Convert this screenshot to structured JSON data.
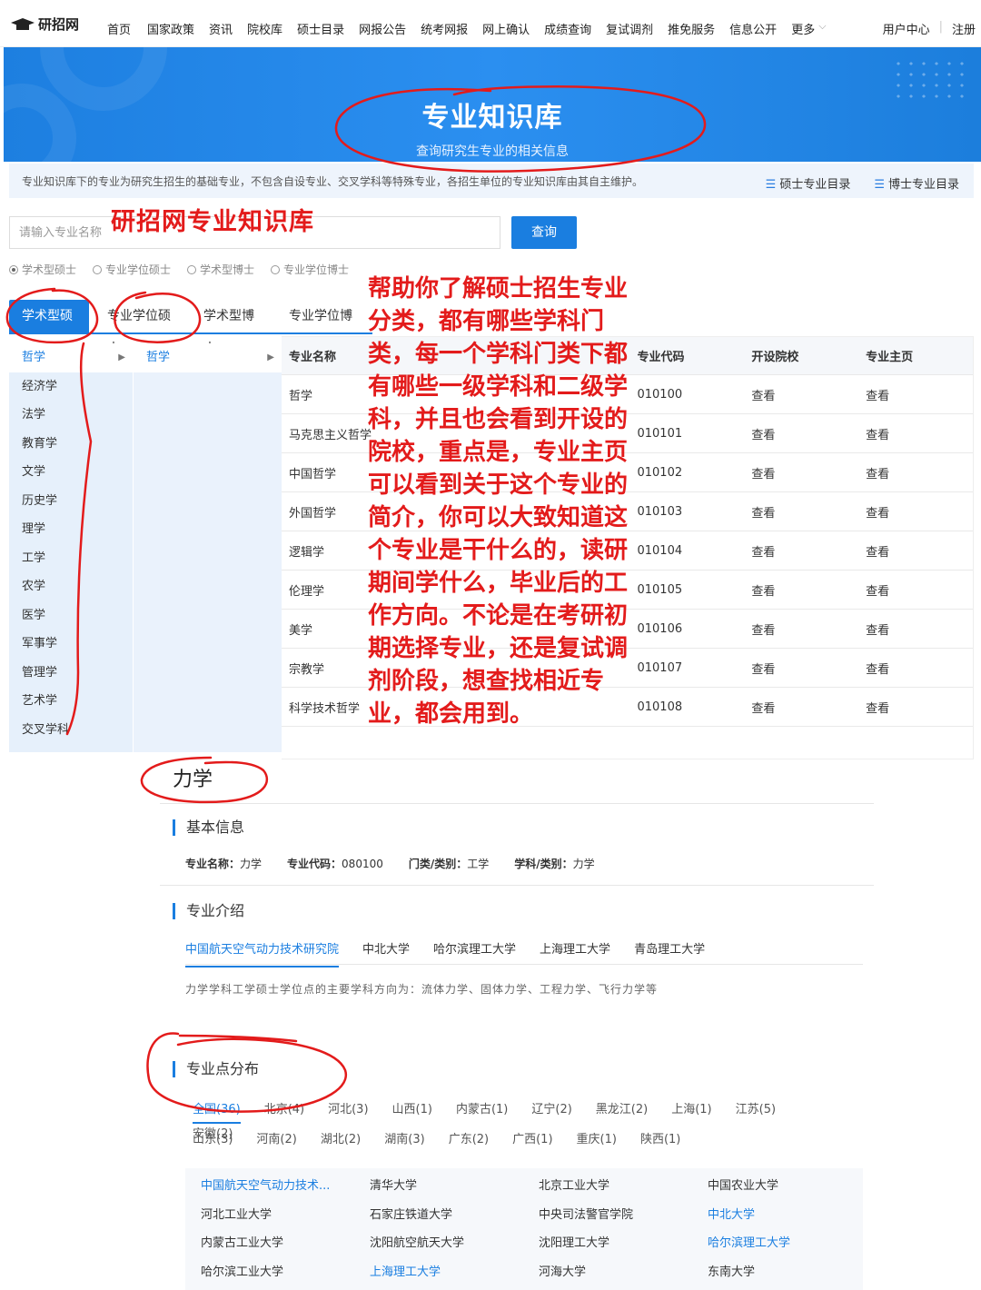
{
  "header": {
    "logo_text": "研招网",
    "nav": [
      "首页",
      "国家政策",
      "资讯",
      "院校库",
      "硕士目录",
      "网报公告",
      "统考网报",
      "网上确认",
      "成绩查询",
      "复试调剂",
      "推免服务",
      "信息公开",
      "更多"
    ],
    "user_center": "用户中心",
    "register": "注册"
  },
  "banner": {
    "title": "专业知识库",
    "subtitle": "查询研究生专业的相关信息"
  },
  "notice": {
    "text": "专业知识库下的专业为研究生招生的基础专业，不包含自设专业、交叉学科等特殊专业，各招生单位的专业知识库由其自主维护。",
    "link_master": "硕士专业目录",
    "link_doctor": "博士专业目录"
  },
  "search": {
    "placeholder": "请输入专业名称",
    "button": "查询",
    "radios": [
      "学术型硕士",
      "专业学位硕士",
      "学术型博士",
      "专业学位博士"
    ]
  },
  "tabs": [
    "学术型硕士",
    "专业学位硕士",
    "学术型博士",
    "专业学位博士"
  ],
  "categories": [
    "哲学",
    "经济学",
    "法学",
    "教育学",
    "文学",
    "历史学",
    "理学",
    "工学",
    "农学",
    "医学",
    "军事学",
    "管理学",
    "艺术学",
    "交叉学科"
  ],
  "subcategory": "哲学",
  "table": {
    "headers": [
      "专业名称",
      "专业代码",
      "开设院校",
      "专业主页"
    ],
    "rows": [
      {
        "name": "哲学",
        "code": "010100",
        "schools": "查看",
        "home": "查看"
      },
      {
        "name": "马克思主义哲学",
        "code": "010101",
        "schools": "查看",
        "home": "查看"
      },
      {
        "name": "中国哲学",
        "code": "010102",
        "schools": "查看",
        "home": "查看"
      },
      {
        "name": "外国哲学",
        "code": "010103",
        "schools": "查看",
        "home": "查看"
      },
      {
        "name": "逻辑学",
        "code": "010104",
        "schools": "查看",
        "home": "查看"
      },
      {
        "name": "伦理学",
        "code": "010105",
        "schools": "查看",
        "home": "查看"
      },
      {
        "name": "美学",
        "code": "010106",
        "schools": "查看",
        "home": "查看"
      },
      {
        "name": "宗教学",
        "code": "010107",
        "schools": "查看",
        "home": "查看"
      },
      {
        "name": "科学技术哲学",
        "code": "010108",
        "schools": "查看",
        "home": "查看"
      }
    ]
  },
  "annotation": {
    "title": "研招网专业知识库",
    "paragraph": "帮助你了解硕士招生专业分类，都有哪些学科门类，每一个学科门类下都有哪些一级学科和二级学科，并且也会看到开设的院校，重点是，专业主页可以看到关于这个专业的简介，你可以大致知道这个专业是干什么的，读研期间学什么，毕业后的工作方向。不论是在考研初期选择专业，还是复试调剂阶段，想查找相近专业，都会用到。"
  },
  "detail": {
    "major_title": "力学",
    "basic_info_heading": "基本信息",
    "fields": [
      {
        "label": "专业名称：",
        "value": "力学"
      },
      {
        "label": "专业代码：",
        "value": "080100"
      },
      {
        "label": "门类/类别：",
        "value": "工学"
      },
      {
        "label": "学科/类别：",
        "value": "力学"
      }
    ],
    "intro_heading": "专业介绍",
    "intro_tabs": [
      "中国航天空气动力技术研究院",
      "中北大学",
      "哈尔滨理工大学",
      "上海理工大学",
      "青岛理工大学"
    ],
    "intro_text": "力学学科工学硕士学位点的主要学科方向为：流体力学、固体力学、工程力学、飞行力学等",
    "distribution_heading": "专业点分布",
    "regions_row1": [
      "全国(36)",
      "北京(4)",
      "河北(3)",
      "山西(1)",
      "内蒙古(1)",
      "辽宁(2)",
      "黑龙江(2)",
      "上海(1)",
      "江苏(5)",
      "安徽(2)"
    ],
    "regions_row2": [
      "山东(3)",
      "河南(2)",
      "湖北(2)",
      "湖南(3)",
      "广东(2)",
      "广西(1)",
      "重庆(1)",
      "陕西(1)"
    ],
    "universities": [
      {
        "name": "中国航天空气动力技术...",
        "highlight": true
      },
      {
        "name": "清华大学",
        "highlight": false
      },
      {
        "name": "北京工业大学",
        "highlight": false
      },
      {
        "name": "中国农业大学",
        "highlight": false
      },
      {
        "name": "河北工业大学",
        "highlight": false
      },
      {
        "name": "石家庄铁道大学",
        "highlight": false
      },
      {
        "name": "中央司法警官学院",
        "highlight": false
      },
      {
        "name": "中北大学",
        "highlight": true
      },
      {
        "name": "内蒙古工业大学",
        "highlight": false
      },
      {
        "name": "沈阳航空航天大学",
        "highlight": false
      },
      {
        "name": "沈阳理工大学",
        "highlight": false
      },
      {
        "name": "哈尔滨理工大学",
        "highlight": true
      },
      {
        "name": "哈尔滨工业大学",
        "highlight": false
      },
      {
        "name": "上海理工大学",
        "highlight": true
      },
      {
        "name": "河海大学",
        "highlight": false
      },
      {
        "name": "东南大学",
        "highlight": false
      }
    ]
  },
  "colors": {
    "accent": "#1a7ee0",
    "annotation": "#e31b1b",
    "banner": "#2b8ff0"
  }
}
